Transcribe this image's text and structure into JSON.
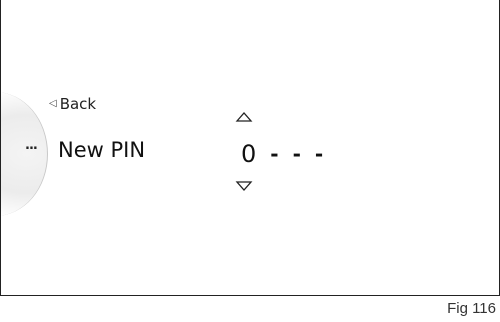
{
  "menu": {
    "back_label": "Back",
    "back_icon": "triangle-left-icon",
    "title": "New PIN",
    "more_icon_text": "..."
  },
  "pin": {
    "digits": [
      "0",
      "-",
      "-",
      "-"
    ],
    "up_icon": "triangle-up-icon",
    "down_icon": "triangle-down-icon"
  },
  "figure": {
    "label": "Fig 116"
  }
}
